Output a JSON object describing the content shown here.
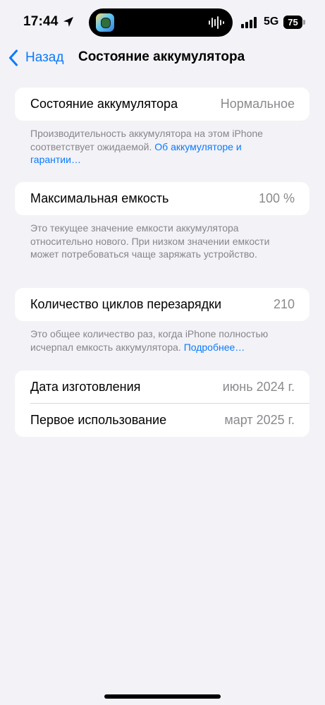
{
  "status_bar": {
    "time": "17:44",
    "network": "5G",
    "battery_level": "75",
    "battery_fraction": 0.75,
    "location_icon": "location-arrow-icon",
    "signal_icon": "cellular-signal-icon",
    "live_activity_icon": "audio-waveform-icon"
  },
  "nav": {
    "back_label": "Назад",
    "title": "Состояние аккумулятора"
  },
  "sections": {
    "battery_state": {
      "label": "Состояние аккумулятора",
      "value": "Нормальное",
      "footer_text": "Производительность аккумулятора на этом iPhone соответствует ожидаемой. ",
      "footer_link": "Об аккумуляторе и гарантии…"
    },
    "max_capacity": {
      "label": "Максимальная емкость",
      "value": "100 %",
      "footer_text": "Это текущее значение емкости аккумулятора относительно нового. При низком значении емкости может потребоваться чаще заряжать устройство."
    },
    "cycle_count": {
      "label": "Количество циклов перезарядки",
      "value": "210",
      "footer_text": "Это общее количество раз, когда iPhone полностью исчерпал емкость аккумулятора. ",
      "footer_link": "Подробнее…"
    },
    "dates": {
      "manufacture_label": "Дата изготовления",
      "manufacture_value": "июнь 2024 г.",
      "first_use_label": "Первое использование",
      "first_use_value": "март 2025 г."
    }
  },
  "colors": {
    "background": "#f2f2f7",
    "accent": "#0a7aff",
    "secondary_text": "#8a8a8e"
  }
}
